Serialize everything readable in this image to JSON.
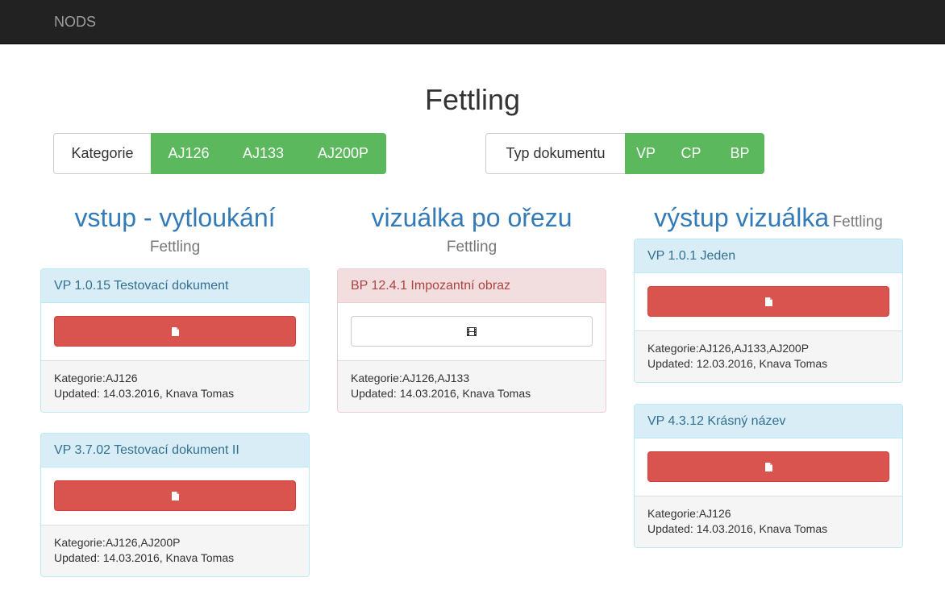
{
  "navbar": {
    "brand": "NODS"
  },
  "page": {
    "title": "Fettling"
  },
  "filters": {
    "kategorie": {
      "label": "Kategorie",
      "options": [
        "AJ126",
        "AJ133",
        "AJ200P"
      ]
    },
    "typ": {
      "label": "Typ dokumentu",
      "options": [
        "VP",
        "CP",
        "BP"
      ]
    }
  },
  "columns": [
    {
      "title": "vstup - vytloukání",
      "subtitle": "Fettling",
      "panels": [
        {
          "heading": "VP 1.0.15 Testovací dokument",
          "type": "file",
          "style": "info",
          "kategorie": "Kategorie:AJ126",
          "updated": "Updated: 14.03.2016, Knava Tomas"
        },
        {
          "heading": "VP 3.7.02 Testovací dokument II",
          "type": "file",
          "style": "info",
          "kategorie": "Kategorie:AJ126,AJ200P",
          "updated": "Updated: 14.03.2016, Knava Tomas"
        }
      ]
    },
    {
      "title": "vizuálka po ořezu",
      "subtitle": "Fettling",
      "panels": [
        {
          "heading": "BP 12.4.1 Impozantní obraz",
          "type": "film",
          "style": "danger",
          "kategorie": "Kategorie:AJ126,AJ133",
          "updated": "Updated: 14.03.2016, Knava Tomas"
        }
      ]
    },
    {
      "title": "výstup vizuálka",
      "subtitle": "Fettling",
      "panels": [
        {
          "heading": "VP 1.0.1 Jeden",
          "type": "file",
          "style": "info",
          "kategorie": "Kategorie:AJ126,AJ133,AJ200P",
          "updated": "Updated: 12.03.2016, Knava Tomas"
        },
        {
          "heading": "VP 4.3.12 Krásný název",
          "type": "file",
          "style": "info",
          "kategorie": "Kategorie:AJ126",
          "updated": "Updated: 14.03.2016, Knava Tomas"
        }
      ]
    }
  ],
  "colors": {
    "navbar": "#222222",
    "success": "#5cb85c",
    "danger": "#d9534f",
    "link": "#337ab7",
    "info_bg": "#d9edf7"
  },
  "icons": {
    "file": "file-icon",
    "film": "film-icon"
  }
}
